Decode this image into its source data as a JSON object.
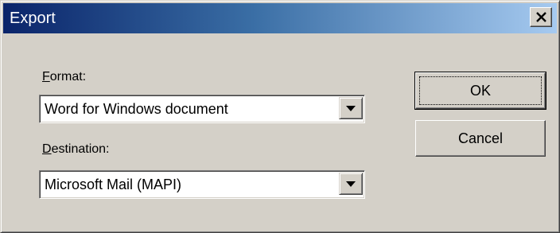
{
  "window": {
    "title": "Export",
    "close_glyph": "✕"
  },
  "format": {
    "label_accel": "F",
    "label_rest": "ormat:",
    "value": "Word for Windows document"
  },
  "destination": {
    "label_accel": "D",
    "label_rest": "estination:",
    "value": "Microsoft Mail (MAPI)"
  },
  "buttons": {
    "ok": "OK",
    "cancel": "Cancel"
  },
  "icons": {
    "close": "close-icon",
    "dropdown": "chevron-down-icon"
  },
  "colors": {
    "face": "#d4d0c8",
    "title_start": "#0a246a",
    "title_end": "#a6caf0"
  }
}
